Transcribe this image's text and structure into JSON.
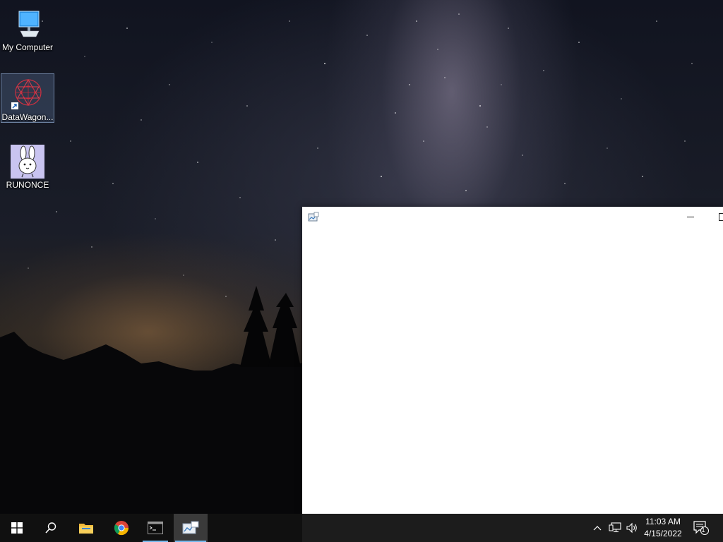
{
  "desktop": {
    "icons": [
      {
        "label": "My Computer",
        "icon": "computer-icon"
      },
      {
        "label": "DataWagon...",
        "icon": "datawagon-icon"
      },
      {
        "label": "RUNONCE",
        "icon": "bunny-icon"
      }
    ]
  },
  "window": {
    "title": "",
    "app_icon": "app-chart-icon"
  },
  "taskbar": {
    "apps": [
      {
        "name": "start",
        "icon": "windows-logo-icon"
      },
      {
        "name": "search",
        "icon": "search-icon"
      },
      {
        "name": "file-explorer",
        "icon": "folder-icon"
      },
      {
        "name": "chrome",
        "icon": "chrome-icon"
      },
      {
        "name": "terminal",
        "icon": "terminal-icon"
      },
      {
        "name": "active-app",
        "icon": "app-chart-icon"
      }
    ],
    "tray": {
      "chevron": "chevron-up-icon",
      "network": "network-icon",
      "volume": "volume-icon",
      "time": "11:03 AM",
      "date": "4/15/2022",
      "notifications_count": "1"
    }
  },
  "colors": {
    "taskbar_bg": "#1c1c1c",
    "accent": "#76b9ed",
    "window_bg": "#ffffff"
  }
}
